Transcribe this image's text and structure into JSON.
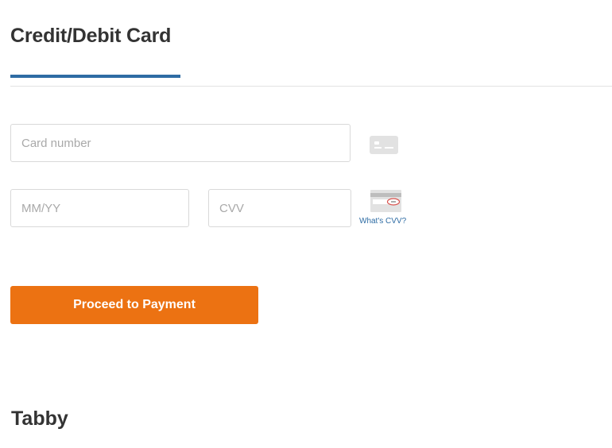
{
  "payment_tab": {
    "title": "Credit/Debit Card"
  },
  "form": {
    "card_number_placeholder": "Card number",
    "expiry_placeholder": "MM/YY",
    "cvv_placeholder": "CVV",
    "cvv_help_link": "What's CVV?",
    "card_icon": "credit-card-icon",
    "cvv_icon": "card-back-cvv-icon",
    "submit_label": "Proceed to Payment"
  },
  "next_section": {
    "title": "Tabby"
  },
  "colors": {
    "accent_blue": "#2e6ca4",
    "button_orange": "#ec7212",
    "text_dark": "#333333",
    "border": "#d9d9d9",
    "placeholder": "#a9a9a9",
    "icon_gray": "#e2e2e2",
    "cvv_highlight": "#d9534f"
  }
}
